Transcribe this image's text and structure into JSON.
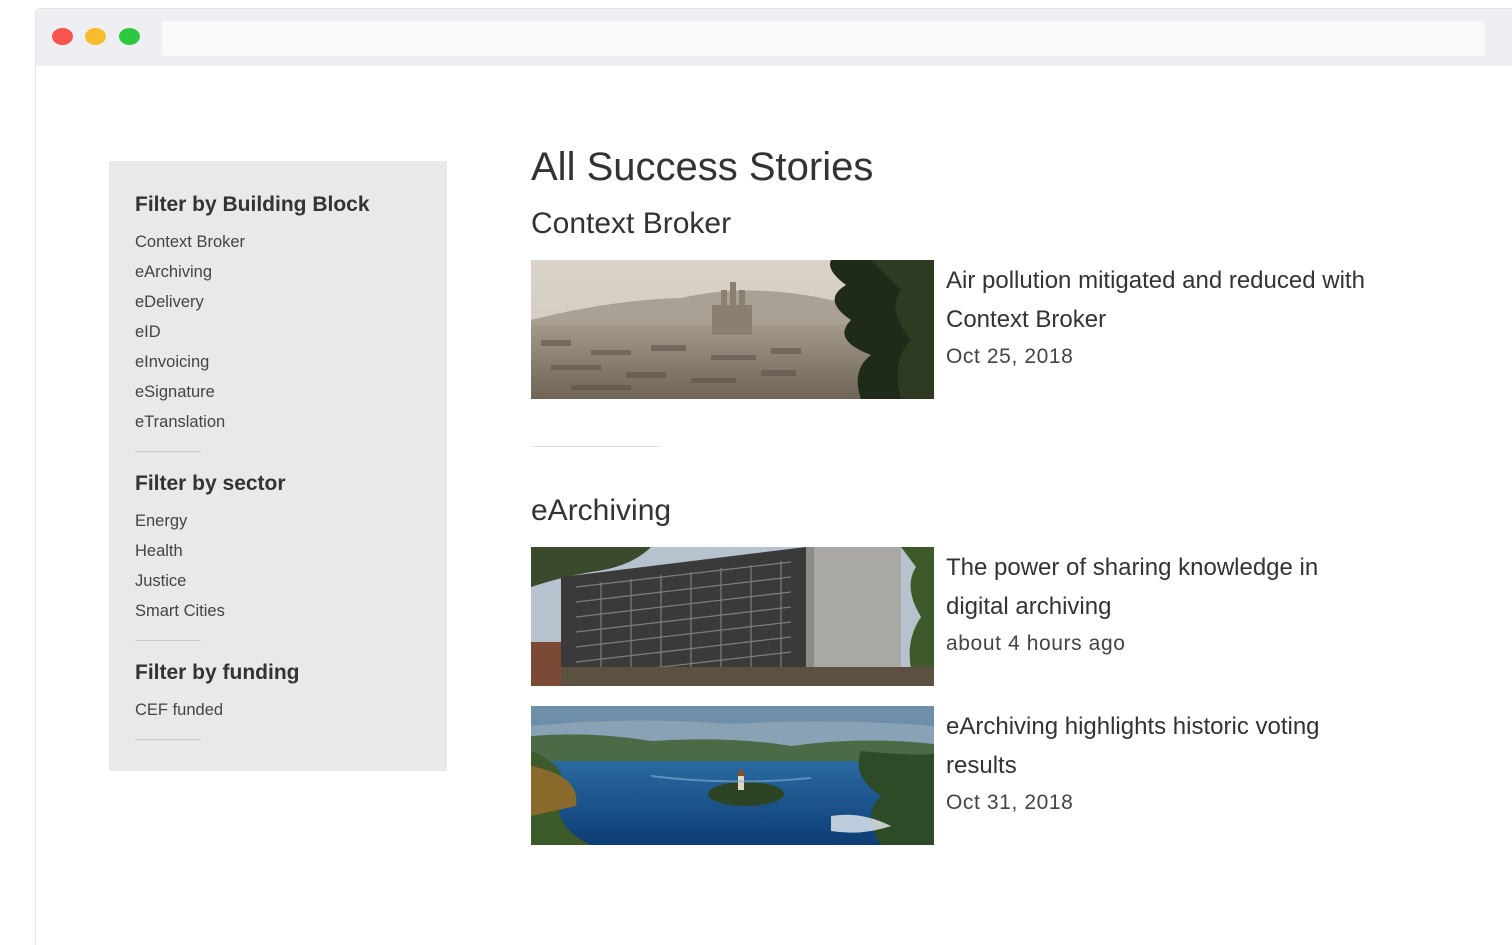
{
  "sidebar": {
    "building_block": {
      "heading": "Filter by Building Block",
      "items": [
        "Context Broker",
        "eArchiving",
        "eDelivery",
        "eID",
        "eInvoicing",
        "eSignature",
        "eTranslation"
      ]
    },
    "sector": {
      "heading": "Filter by sector",
      "items": [
        "Energy",
        "Health",
        "Justice",
        "Smart Cities"
      ]
    },
    "funding": {
      "heading": "Filter by funding",
      "items": [
        "CEF funded"
      ]
    }
  },
  "main": {
    "page_title": "All Success Stories",
    "sections": [
      {
        "title": "Context Broker",
        "stories": [
          {
            "title": "Air pollution mitigated and reduced with Context Broker",
            "date": "Oct 25, 2018"
          }
        ]
      },
      {
        "title": "eArchiving",
        "stories": [
          {
            "title": "The power of sharing knowledge in digital archiving",
            "date": "about 4 hours ago"
          },
          {
            "title": "eArchiving highlights historic voting results",
            "date": "Oct 31, 2018"
          }
        ]
      }
    ]
  },
  "colors": {
    "sidebar_bg": "#e9e9e9",
    "titlebar_bg": "#eeeff3",
    "close": "#f9544d",
    "minimize": "#f8bc2e",
    "maximize": "#2cc940"
  }
}
